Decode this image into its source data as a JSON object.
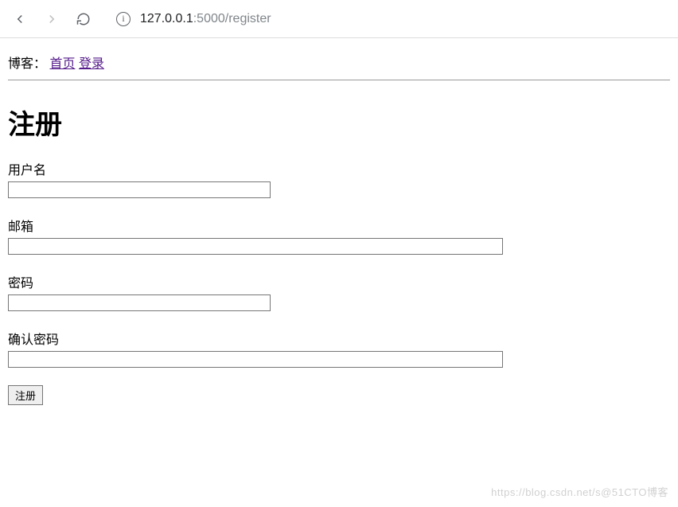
{
  "browser": {
    "url_host": "127.0.0.1",
    "url_port": ":5000",
    "url_path": "/register"
  },
  "header": {
    "label": "博客：",
    "home_link": "首页",
    "login_link": "登录"
  },
  "page": {
    "title": "注册"
  },
  "form": {
    "username_label": "用户名",
    "username_value": "",
    "email_label": "邮箱",
    "email_value": "",
    "password_label": "密码",
    "password_value": "",
    "confirm_label": "确认密码",
    "confirm_value": "",
    "submit_label": "注册"
  },
  "watermark": "https://blog.csdn.net/s@51CTO博客"
}
